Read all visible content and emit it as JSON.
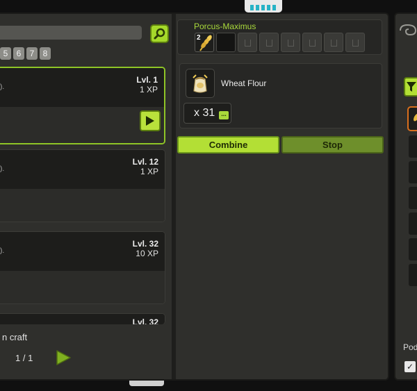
{
  "search": {
    "placeholder": ""
  },
  "pages": [
    "5",
    "6",
    "7",
    "8"
  ],
  "recipes": [
    {
      "level": "Lvl. 1",
      "xp": "1 XP",
      "paren": ")."
    },
    {
      "level": "Lvl. 12",
      "xp": "1 XP",
      "paren": ")."
    },
    {
      "level": "Lvl. 32",
      "xp": "10 XP",
      "paren": ")."
    },
    {
      "level": "Lvl. 32"
    }
  ],
  "footer": {
    "label": "n craft",
    "pager": "1  / 1"
  },
  "inventory": {
    "title": "Porcus-Maximus",
    "first_slot_count": "2"
  },
  "item": {
    "name": "Wheat Flour",
    "quantity": "x 31",
    "qty_button": "..."
  },
  "actions": {
    "combine": "Combine",
    "stop": "Stop"
  },
  "right_panel": {
    "label": "Pod",
    "check": "✓"
  },
  "colors": {
    "accent": "#a9d93b",
    "selected_border": "#8fc526",
    "orange_select": "#d96f1d"
  }
}
